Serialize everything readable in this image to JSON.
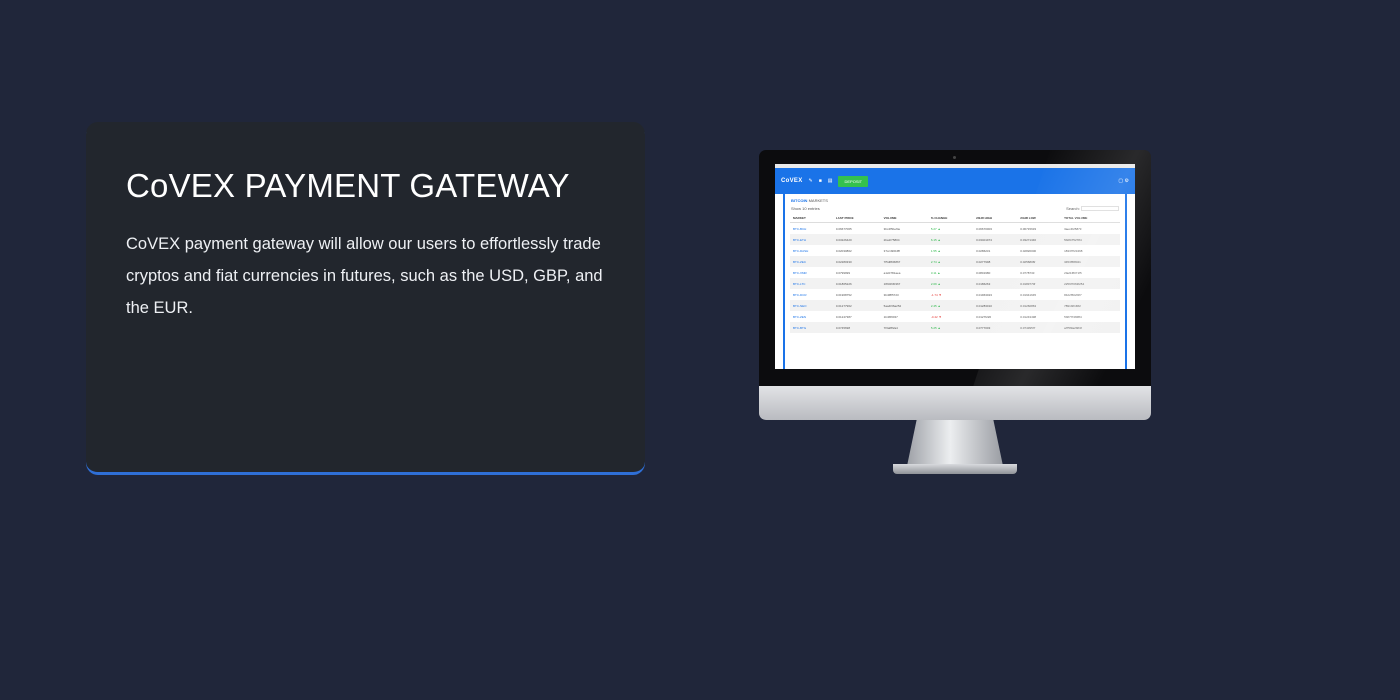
{
  "section": {
    "title": "CoVEX PAYMENT GATEWAY",
    "description": "CoVEX payment gateway will allow our users to effortlessly trade cryptos and fiat currencies in futures, such as the USD, GBP, and the EUR."
  },
  "screen": {
    "brand": "CoVEX",
    "deposit_label": "DEPOSIT",
    "panel_title_strong": "BITCOIN",
    "panel_title_rest": "MARKETS",
    "show_label": "Show",
    "show_value": "10",
    "entries_label": "entries",
    "search_label": "Search:",
    "columns": [
      "MARKET",
      "LAST PRICE",
      "VOLUME",
      "% CHANGE",
      "24HR HIGH",
      "24HR LOW",
      "TOTAL VOLUME"
    ],
    "rows": [
      {
        "market": "BTC-BCH",
        "last": "0.06677065",
        "volume": "3bc4f5bef4e",
        "change": "5.27",
        "dir": "up",
        "high": "0.06670003",
        "low": "0.06715633",
        "total": "3aec4f25873"
      },
      {
        "market": "BTC-ETH",
        "last": "0.03226420",
        "volume": "2ba1f75804",
        "change": "6.15",
        "dir": "up",
        "high": "0.03401974",
        "low": "0.03271346",
        "total": "5b0f4752784"
      },
      {
        "market": "BTC-DASH",
        "last": "0.02030862",
        "volume": "37cc4961f8f",
        "change": "1.55",
        "dir": "up",
        "high": "0.0286231",
        "low": "0.02820000",
        "total": "1833f7f23468"
      },
      {
        "market": "BTC-ZEC",
        "last": "0.02280330",
        "volume": "7f5df836867",
        "change": "2.74",
        "dir": "up",
        "high": "0.0277998",
        "low": "0.0256806f",
        "total": "3453f5f8021"
      },
      {
        "market": "BTC-XMR",
        "last": "0.0799999",
        "volume": "a12d781aea",
        "change": "3.11",
        "dir": "up",
        "high": "0.0801980",
        "low": "0.0778733",
        "total": "2fa21f8071f5"
      },
      {
        "market": "BTC-LTC",
        "last": "0.01865226",
        "volume": "1f8326f0367",
        "change": "2.09",
        "dir": "up",
        "high": "0.0186263",
        "low": "0.0183770f",
        "total": "2259f7063f254"
      },
      {
        "market": "BTC-DCR",
        "last": "0.01968752",
        "volume": "3b4f8f5723",
        "change": "-1.74",
        "dir": "dn",
        "high": "0.01963023",
        "low": "0.01941645",
        "total": "8422f502f2f7"
      },
      {
        "market": "BTC-NEO",
        "last": "0.01277962",
        "volume": "5aa4f36a252",
        "change": "2.45",
        "dir": "up",
        "high": "0.01283010",
        "low": "0.01260863",
        "total": "7891f2f1f0f2"
      },
      {
        "market": "BTC-ZEN",
        "last": "0.01247387",
        "volume": "1b4f6f0f47",
        "change": "-0.42",
        "dir": "dn",
        "high": "0.0127f226",
        "low": "0.01243498",
        "total": "5f2f77f4f0f84"
      },
      {
        "market": "BTC-BTG",
        "last": "0.0745698",
        "volume": "7f3af8f2a4",
        "change": "5.25",
        "dir": "up",
        "high": "0.0777003",
        "low": "0.0743957f",
        "total": "a7f5f3a2f2f4f"
      }
    ]
  },
  "colors": {
    "page_bg": "#20263a",
    "card_bg": "#22262d",
    "accent": "#2f6fd6",
    "app_blue": "#1a73e8",
    "deposit_green": "#34c14e"
  }
}
